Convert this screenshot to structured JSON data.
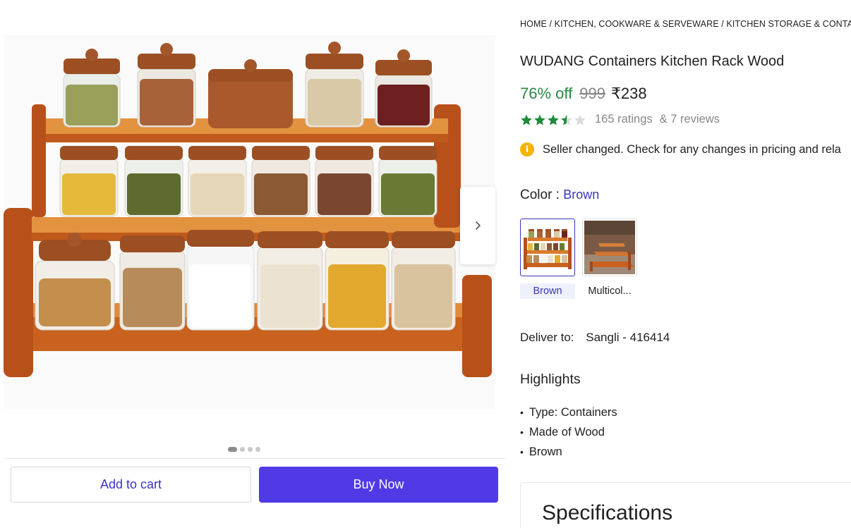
{
  "breadcrumb": [
    "HOME",
    "KITCHEN, COOKWARE & SERVEWARE",
    "KITCHEN STORAGE & CONTAIN"
  ],
  "breadcrumb_sep": "/",
  "product": {
    "title": "WUDANG Containers Kitchen Rack Wood",
    "discount": "76% off",
    "mrp": "999",
    "price": "₹238",
    "rating_value": 3.5,
    "ratings_text": "165 ratings",
    "reviews_text": "& 7 reviews"
  },
  "seller_notice": "Seller changed. Check for any changes in pricing and rela",
  "color": {
    "label": "Color :",
    "selected": "Brown",
    "options": [
      {
        "label": "Brown",
        "selected": true
      },
      {
        "label": "Multicol...",
        "selected": false
      }
    ]
  },
  "delivery": {
    "label": "Deliver to:",
    "value": "Sangli - 416414"
  },
  "highlights": {
    "title": "Highlights",
    "items": [
      "Type: Containers",
      "Made of Wood",
      "Brown"
    ]
  },
  "specifications": {
    "title": "Specifications"
  },
  "actions": {
    "add_to_cart": "Add to cart",
    "buy_now": "Buy Now"
  },
  "gallery": {
    "image_count": 4,
    "active_index": 0
  },
  "colors": {
    "discount_green": "#27883f",
    "accent_blue": "#3a37b5",
    "buy_button": "#4f3ae6",
    "star_green": "#1f8b3b",
    "info_yellow": "#f5b400"
  }
}
